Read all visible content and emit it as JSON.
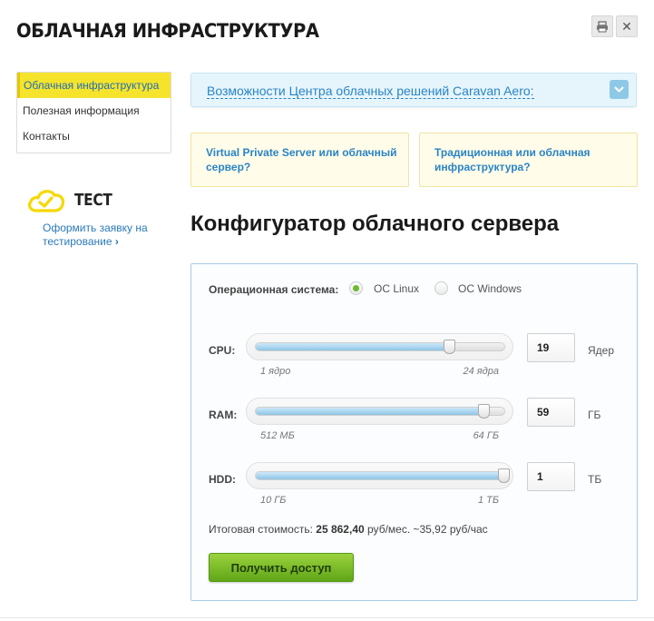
{
  "header": {
    "title": "ОБЛАЧНАЯ ИНФРАСТРУКТУРА",
    "print_icon": "printer-icon",
    "close_icon": "close-icon",
    "close_glyph": "✕"
  },
  "sidebar": {
    "items": [
      {
        "label": "Облачная инфраструктура",
        "active": true
      },
      {
        "label": "Полезная информация",
        "active": false
      },
      {
        "label": "Контакты",
        "active": false
      }
    ]
  },
  "test_block": {
    "icon": "cloud-check-icon",
    "title": "ТЕСТ",
    "link": "Оформить заявку на тестирование",
    "link_arrow": "›",
    "accent": "#f5e32c"
  },
  "features": {
    "text": "Возможности Центра облачных решений Caravan Aero:",
    "chevron_icon": "chevron-down-icon"
  },
  "cards": [
    {
      "text": "Virtual Private Server или облачный сервер?"
    },
    {
      "text": "Традиционная или облачная инфраструктура?"
    }
  ],
  "configurator": {
    "title": "Конфигуратор облачного сервера",
    "os": {
      "label": "Операционная система:",
      "options": [
        "ОС Linux",
        "ОС Windows"
      ],
      "selected": "ОС Linux"
    },
    "sliders": [
      {
        "label": "CPU:",
        "min_label": "1 ядро",
        "max_label": "24 ядра",
        "min": 1,
        "max": 24,
        "value": 19,
        "display": "19",
        "unit": "Ядер"
      },
      {
        "label": "RAM:",
        "min_label": "512 МБ",
        "max_label": "64 ГБ",
        "min": 0.5,
        "max": 64,
        "value": 59,
        "display": "59",
        "unit": "ГБ"
      },
      {
        "label": "HDD:",
        "min_label": "10 ГБ",
        "max_label": "1 ТБ",
        "min": 10,
        "max": 1000,
        "value": 1000,
        "display": "1",
        "unit": "ТБ"
      }
    ],
    "total_label": "Итоговая стоимость:",
    "total_value": "25 862,40",
    "total_suffix": "руб/мес. ~35,92 руб/час",
    "cta_label": "Получить доступ"
  },
  "colors": {
    "brand_blue": "#2a84c4",
    "accent_yellow": "#f5e32c",
    "cta_green": "#6dbb2d"
  }
}
